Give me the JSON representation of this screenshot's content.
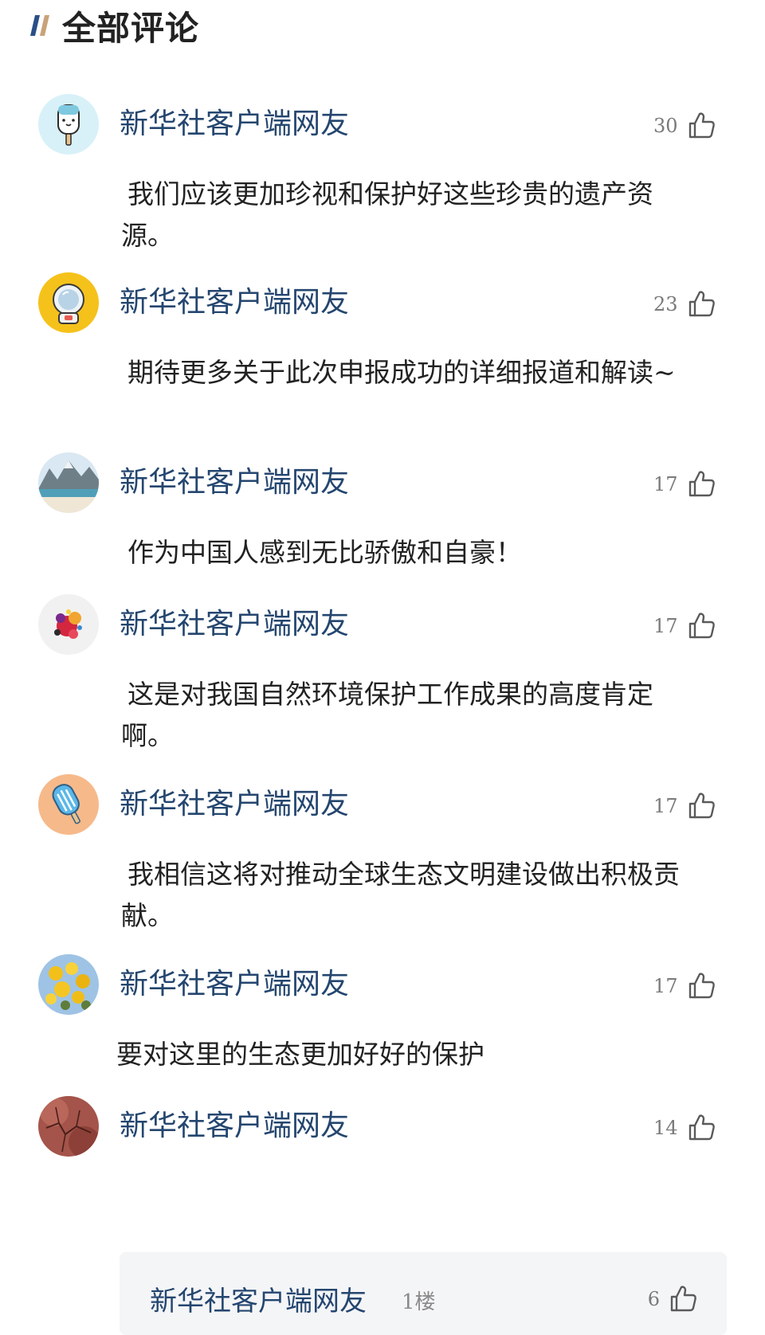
{
  "header": {
    "title": "全部评论",
    "accent_colors": [
      "#2a4f86",
      "#c9a27a"
    ]
  },
  "comments": [
    {
      "username": "新华社客户端网友",
      "likes": "30",
      "text": "我们应该更加珍视和保护好这些珍贵的遗产资源。",
      "avatar_icon": "ice-pop-icon"
    },
    {
      "username": "新华社客户端网友",
      "likes": "23",
      "text": "期待更多关于此次申报成功的详细报道和解读~",
      "avatar_icon": "astronaut-helmet-icon"
    },
    {
      "username": "新华社客户端网友",
      "likes": "17",
      "text": "作为中国人感到无比骄傲和自豪！",
      "avatar_icon": "landscape-icon"
    },
    {
      "username": "新华社客户端网友",
      "likes": "17",
      "text": "这是对我国自然环境保护工作成果的高度肯定啊。",
      "avatar_icon": "paint-splash-icon"
    },
    {
      "username": "新华社客户端网友",
      "likes": "17",
      "text": "我相信这将对推动全球生态文明建设做出积极贡献。",
      "avatar_icon": "popsicle-icon"
    },
    {
      "username": "新华社客户端网友",
      "likes": "17",
      "text": "要对这里的生态更加好好的保护",
      "avatar_icon": "yellow-flowers-icon"
    },
    {
      "username": "新华社客户端网友",
      "likes": "14",
      "text": "",
      "avatar_icon": "cracked-earth-icon"
    }
  ],
  "reply": {
    "username": "新华社客户端网友",
    "floor": "1楼",
    "likes": "6"
  },
  "icons": {
    "like": "thumbs-up-icon"
  },
  "colors": {
    "username": "#24466f",
    "body_text": "#222222",
    "like_count": "#7a7a7a",
    "reply_bg": "#f4f5f7"
  }
}
